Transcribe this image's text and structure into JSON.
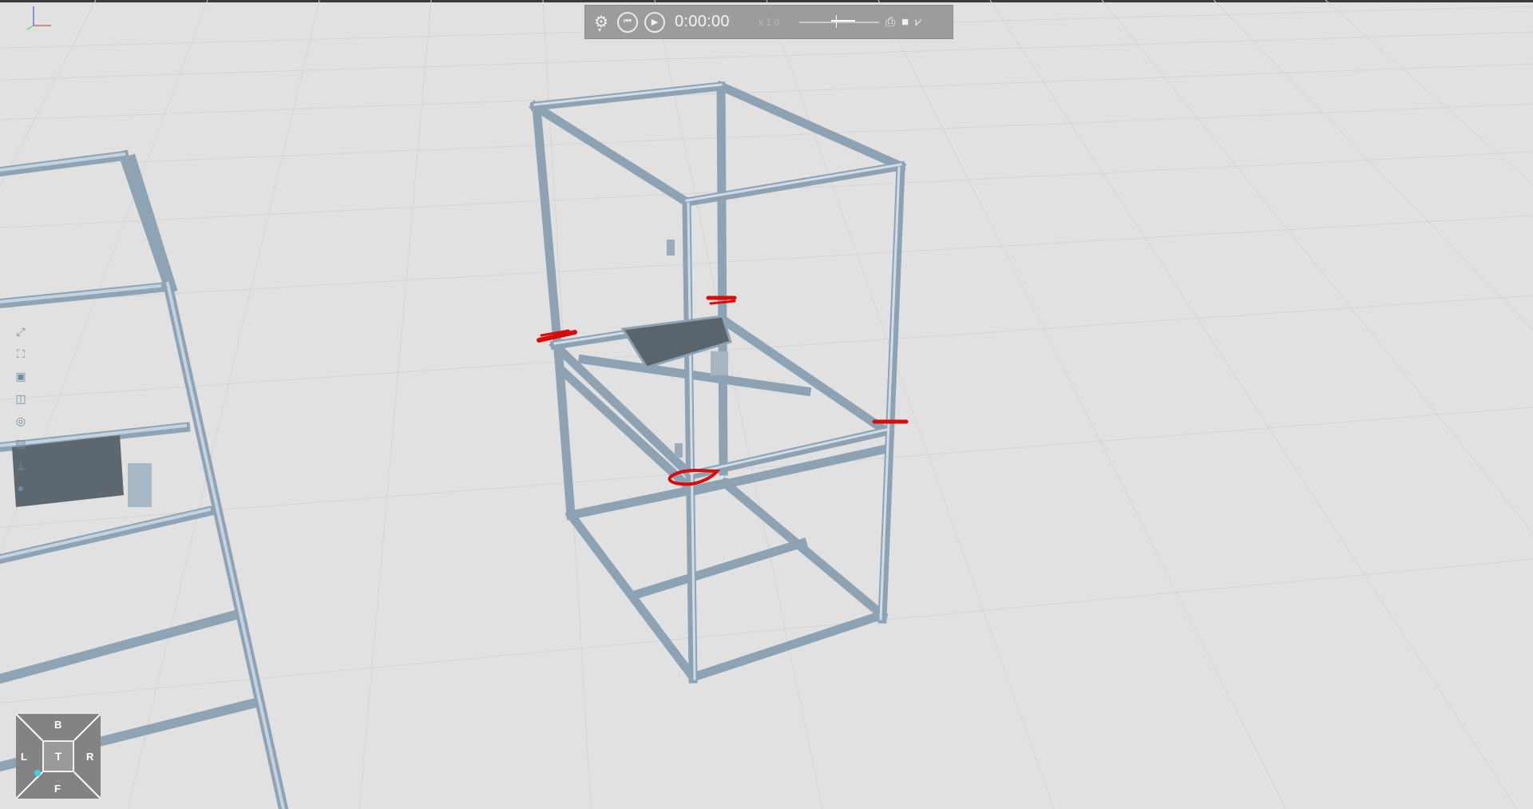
{
  "playback": {
    "time": "0:00:00",
    "speed": "x 1.0"
  },
  "icons": {
    "settings": "gear-icon",
    "rewind": "skip-to-start-icon",
    "play": "play-icon",
    "export_pdf": "pdf-icon",
    "record": "camera-icon",
    "more": "share-icon"
  },
  "viewcube": {
    "back": "B",
    "front": "F",
    "left": "L",
    "right": "R",
    "top": "T"
  },
  "colors": {
    "background": "#e1e1e1",
    "frame": "#a9bccc",
    "markup": "#d90b0b",
    "toolbar": "#9b9c9d",
    "highlight": "#38d1e8"
  }
}
